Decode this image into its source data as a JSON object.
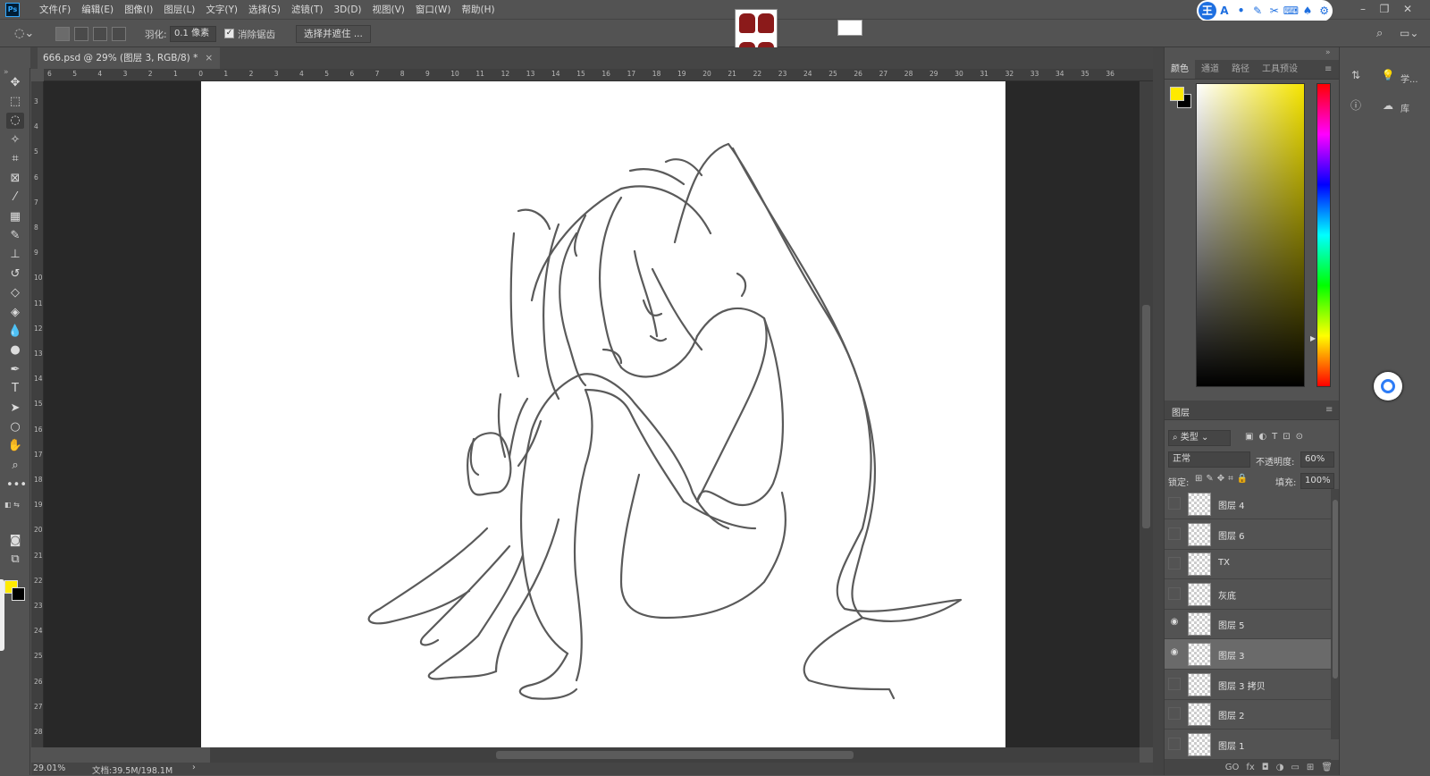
{
  "app": {
    "logo_text": "Ps"
  },
  "menu": [
    "文件(F)",
    "编辑(E)",
    "图像(I)",
    "图层(L)",
    "文字(Y)",
    "选择(S)",
    "滤镜(T)",
    "3D(D)",
    "视图(V)",
    "窗口(W)",
    "帮助(H)"
  ],
  "options": {
    "feather_label": "羽化:",
    "feather_value": "0.1 像素",
    "antialias_label": "消除锯齿",
    "select_mask_button": "选择并遮住 ..."
  },
  "ime": {
    "cells": [
      "王",
      "A",
      "•",
      "✎",
      "✂",
      "⌨",
      "♠",
      "⚙"
    ]
  },
  "document": {
    "tab_title": "666.psd @ 29% (图层 3, RGB/8) *",
    "close": "×"
  },
  "ruler": {
    "top_labels": [
      "6",
      "5",
      "4",
      "3",
      "2",
      "1",
      "0",
      "1",
      "2",
      "3",
      "4",
      "5",
      "6",
      "7",
      "8",
      "9",
      "10",
      "11",
      "12",
      "13",
      "14",
      "15",
      "16",
      "17",
      "18",
      "19",
      "20",
      "21",
      "22",
      "23",
      "24",
      "25",
      "26",
      "27",
      "28",
      "29",
      "30",
      "31",
      "32",
      "33",
      "34",
      "35",
      "36"
    ],
    "left_labels": [
      "3",
      "4",
      "5",
      "6",
      "7",
      "8",
      "9",
      "10",
      "11",
      "12",
      "13",
      "14",
      "15",
      "16",
      "17",
      "18",
      "19",
      "20",
      "21",
      "22",
      "23",
      "24",
      "25",
      "26",
      "27",
      "28"
    ]
  },
  "status": {
    "zoom": "29.01%",
    "doc_info": "文档:39.5M/198.1M",
    "arrow": "›"
  },
  "color_panel": {
    "tabs": [
      "颜色",
      "通道",
      "路径",
      "工具预设"
    ],
    "foreground": "#ffea00",
    "background": "#000000"
  },
  "layers_panel": {
    "title": "图层",
    "filter_label": "类型",
    "blend_mode": "正常",
    "opacity_label": "不透明度:",
    "opacity_value": "60%",
    "lock_label": "锁定:",
    "fill_label": "填充:",
    "fill_value": "100%",
    "layers": [
      {
        "name": "图层 4",
        "visible": false,
        "selected": false
      },
      {
        "name": "图层 6",
        "visible": false,
        "selected": false
      },
      {
        "name": "TX",
        "visible": false,
        "selected": false
      },
      {
        "name": "灰底",
        "visible": false,
        "selected": false
      },
      {
        "name": "图层 5",
        "visible": true,
        "selected": false
      },
      {
        "name": "图层 3",
        "visible": true,
        "selected": true
      },
      {
        "name": "图层 3 拷贝",
        "visible": false,
        "selected": false
      },
      {
        "name": "图层 2",
        "visible": false,
        "selected": false
      },
      {
        "name": "图层 1",
        "visible": false,
        "selected": false
      }
    ],
    "footer_icons": [
      "GO",
      "fx",
      "◘",
      "◑",
      "▭",
      "⊞",
      "🗑"
    ]
  },
  "side_strip": {
    "learn_label": "学...",
    "libraries_label": "库"
  },
  "colors": {
    "accent": "#31a8ff",
    "panel": "#535353",
    "dark": "#282828"
  }
}
